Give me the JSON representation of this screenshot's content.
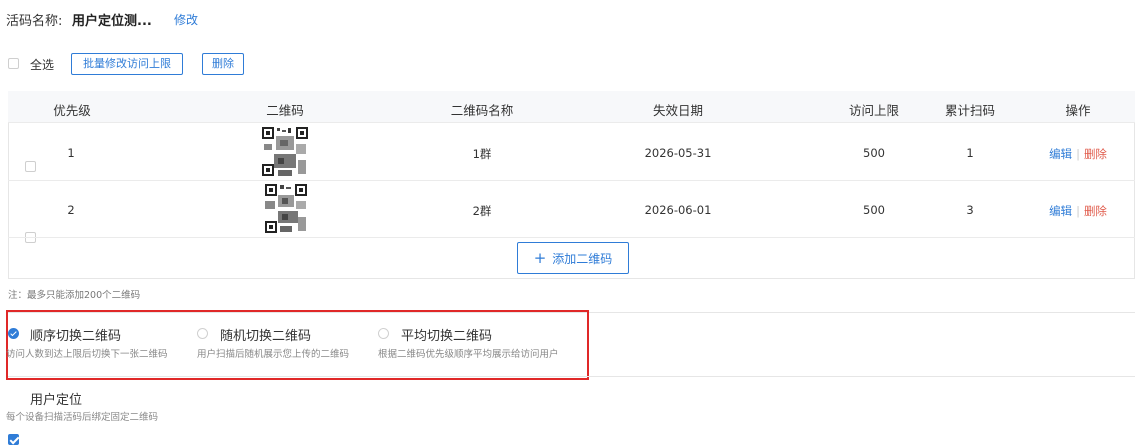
{
  "header": {
    "label": "活码名称:",
    "value": "用户定位测...",
    "edit": "修改"
  },
  "toolbar": {
    "select_all": "全选",
    "batch_edit": "批量修改访问上限",
    "delete": "删除"
  },
  "table": {
    "columns": [
      "优先级",
      "二维码",
      "二维码名称",
      "失效日期",
      "访问上限",
      "累计扫码",
      "操作"
    ],
    "rows": [
      {
        "priority": "1",
        "name": "1群",
        "expire": "2026-05-31",
        "limit": "500",
        "scans": "1",
        "edit": "编辑",
        "delete": "删除"
      },
      {
        "priority": "2",
        "name": "2群",
        "expire": "2026-06-01",
        "limit": "500",
        "scans": "3",
        "edit": "编辑",
        "delete": "删除"
      }
    ],
    "add_button": "添加二维码",
    "add_icon": "plus-icon"
  },
  "note": "注：最多只能添加200个二维码",
  "switch_modes": [
    {
      "label": "顺序切换二维码",
      "desc": "访问人数到达上限后切换下一张二维码",
      "selected": true
    },
    {
      "label": "随机切换二维码",
      "desc": "用户扫描后随机展示您上传的二维码",
      "selected": false
    },
    {
      "label": "平均切换二维码",
      "desc": "根据二维码优先级顺序平均展示给访问用户",
      "selected": false
    }
  ],
  "user_location": {
    "label": "用户定位",
    "desc": "每个设备扫描活码后绑定固定二维码",
    "checked": true
  },
  "colors": {
    "accent": "#2f7cd7",
    "danger": "#e05a4a",
    "highlight_box": "#e02828"
  }
}
